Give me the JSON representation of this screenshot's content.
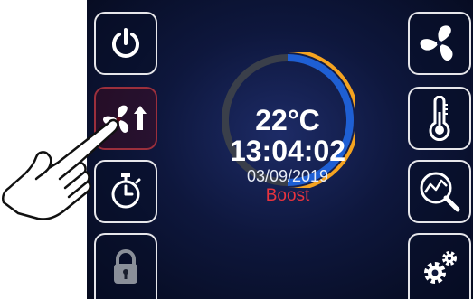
{
  "display": {
    "temperature": "22°C",
    "time": "13:04:02",
    "date": "03/09/2019",
    "mode": "Boost"
  },
  "colors": {
    "ring_track": "#3a3f4a",
    "ring_blue": "#1e5fd4",
    "ring_orange": "#f5a320",
    "mode_text": "#e8343f",
    "active_border": "#9b2f3c"
  },
  "left_buttons": [
    {
      "icon": "power-icon"
    },
    {
      "icon": "fan-boost-icon",
      "active": true
    },
    {
      "icon": "timer-icon"
    },
    {
      "icon": "lock-icon"
    }
  ],
  "right_buttons": [
    {
      "icon": "fan-icon"
    },
    {
      "icon": "thermometer-icon"
    },
    {
      "icon": "chart-search-icon"
    },
    {
      "icon": "settings-icon"
    }
  ]
}
